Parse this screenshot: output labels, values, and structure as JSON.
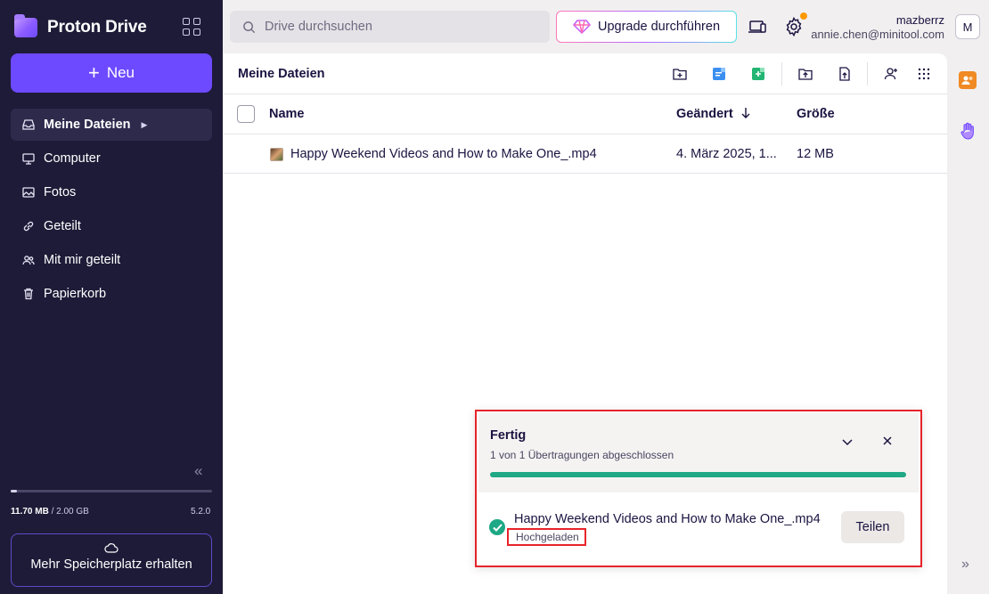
{
  "app": {
    "name": "Proton Drive",
    "brand_color": "#6d4aff",
    "sidebar_bg": "#1e1b38"
  },
  "sidebar": {
    "new_button": "Neu",
    "items": [
      {
        "label": "Meine Dateien",
        "icon": "inbox-icon",
        "active": true
      },
      {
        "label": "Computer",
        "icon": "computer-icon",
        "active": false
      },
      {
        "label": "Fotos",
        "icon": "image-icon",
        "active": false
      },
      {
        "label": "Geteilt",
        "icon": "link-icon",
        "active": false
      },
      {
        "label": "Mit mir geteilt",
        "icon": "users-icon",
        "active": false
      },
      {
        "label": "Papierkorb",
        "icon": "trash-icon",
        "active": false
      }
    ],
    "storage_used": "11.70 MB",
    "storage_total": "/ 2.00 GB",
    "storage_fraction": 0.006,
    "version": "5.2.0",
    "more_storage": "Mehr Speicherplatz erhalten"
  },
  "topbar": {
    "search_placeholder": "Drive durchsuchen",
    "upgrade_label": "Upgrade durchführen",
    "user_name": "mazberrz",
    "user_email": "annie.chen@minitool.com",
    "avatar_initial": "M",
    "settings_badge_color": "#ff9900"
  },
  "main": {
    "title": "Meine Dateien",
    "columns": {
      "name": "Name",
      "modified": "Geändert",
      "size": "Größe"
    },
    "files": [
      {
        "name": "Happy Weekend Videos and How to Make One_.mp4",
        "modified": "4. März 2025, 1...",
        "size": "12 MB"
      }
    ]
  },
  "transfer": {
    "title": "Fertig",
    "subtitle": "1 von 1 Übertragungen abgeschlossen",
    "progress": 1.0,
    "progress_color": "#1ea885",
    "item_name": "Happy Weekend Videos and How to Make One_.mp4",
    "item_status": "Hochgeladen",
    "share_label": "Teilen"
  }
}
